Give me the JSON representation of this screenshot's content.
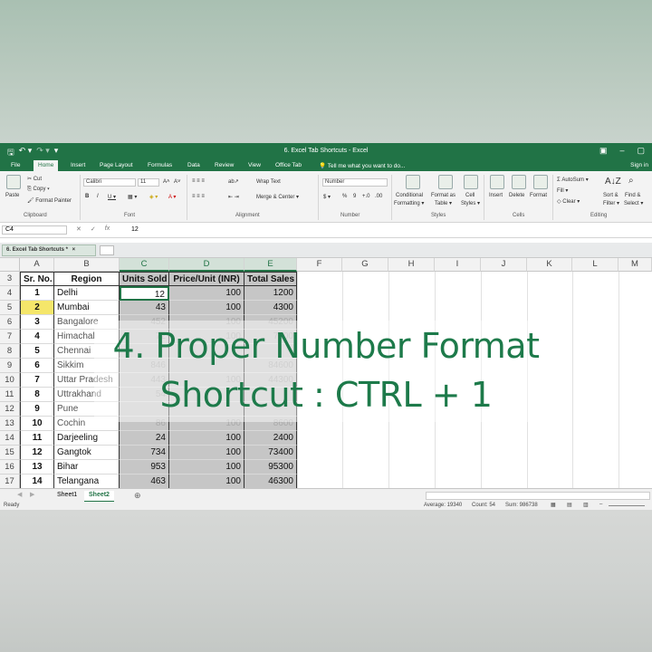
{
  "window": {
    "title": "6. Excel Tab Shortcuts - Excel",
    "sign_in": "Sign in",
    "qat_save": "🖫",
    "qat_undo": "↶ ▾",
    "qat_redo": "↷ ▾",
    "qat_more": "▾",
    "win_ribbon": "▣",
    "win_min": "–",
    "win_max": "▢"
  },
  "ribbon_tabs": [
    "File",
    "Home",
    "Insert",
    "Page Layout",
    "Formulas",
    "Data",
    "Review",
    "View",
    "Office Tab"
  ],
  "tell_me": "💡 Tell me what you want to do...",
  "ribbon": {
    "clipboard": {
      "paste": "Paste",
      "cut": "✂ Cut",
      "copy": "⎘ Copy ▾",
      "format_painter": "🖌 Format Painter",
      "label": "Clipboard"
    },
    "font": {
      "name": "Calibri",
      "size": "11",
      "grow": "A˄",
      "shrink": "A˅",
      "bold": "B",
      "italic": "I",
      "underline": "U ▾",
      "borders": "▦ ▾",
      "fill": "◈ ▾",
      "color": "A ▾",
      "label": "Font"
    },
    "alignment": {
      "wrap": "Wrap Text",
      "merge": "Merge & Center ▾",
      "label": "Alignment"
    },
    "number": {
      "format": "Number",
      "currency": "$ ▾",
      "percent": "%",
      "comma": "9",
      "inc": "+.0",
      "dec": ".00",
      "label": "Number"
    },
    "styles": {
      "cond": "Conditional",
      "cond2": "Formatting ▾",
      "table": "Format as",
      "table2": "Table ▾",
      "cell": "Cell",
      "cell2": "Styles ▾",
      "label": "Styles"
    },
    "cells": {
      "insert": "Insert",
      "delete": "Delete",
      "format": "Format",
      "label": "Cells"
    },
    "editing": {
      "autosum": "Σ AutoSum ▾",
      "fill": "Fill ▾",
      "clear": "◇ Clear ▾",
      "sort": "Sort &",
      "sort2": "Filter ▾",
      "find": "Find &",
      "find2": "Select ▾",
      "label": "Editing"
    }
  },
  "formula_bar": {
    "name_box": "C4",
    "cancel": "✕",
    "enter": "✓",
    "fx": "fx",
    "value": "12"
  },
  "file_tab": {
    "label": "6. Excel Tab Shortcuts *",
    "close": "×"
  },
  "columns": [
    "A",
    "B",
    "C",
    "D",
    "E",
    "F",
    "G",
    "H",
    "I",
    "J",
    "K",
    "L",
    "M"
  ],
  "headers": {
    "row": "3",
    "sr": "Sr. No.",
    "region": "Region",
    "units": "Units Sold",
    "price": "Price/Unit (INR)",
    "total": "Total Sales"
  },
  "rows": [
    {
      "row": "4",
      "sr": "1",
      "region": "Delhi",
      "units": "12",
      "price": "100",
      "total": "1200"
    },
    {
      "row": "5",
      "sr": "2",
      "region": "Mumbai",
      "units": "43",
      "price": "100",
      "total": "4300"
    },
    {
      "row": "6",
      "sr": "3",
      "region": "Bangalore",
      "units": "452",
      "price": "100",
      "total": "45200"
    },
    {
      "row": "7",
      "sr": "4",
      "region": "Himachal",
      "units": "72",
      "price": "100",
      "total": "7200"
    },
    {
      "row": "8",
      "sr": "5",
      "region": "Chennai",
      "units": "",
      "price": "",
      "total": ""
    },
    {
      "row": "9",
      "sr": "6",
      "region": "Sikkim",
      "units": "846",
      "price": "",
      "total": "84600"
    },
    {
      "row": "10",
      "sr": "7",
      "region": "Uttar Pradesh",
      "units": "443",
      "price": "100",
      "total": "44300"
    },
    {
      "row": "11",
      "sr": "8",
      "region": "Uttrakhand",
      "units": "54",
      "price": "",
      "total": ""
    },
    {
      "row": "12",
      "sr": "9",
      "region": "Pune",
      "units": "",
      "price": "",
      "total": ""
    },
    {
      "row": "13",
      "sr": "10",
      "region": "Cochin",
      "units": "86",
      "price": "100",
      "total": "8600"
    },
    {
      "row": "14",
      "sr": "11",
      "region": "Darjeeling",
      "units": "24",
      "price": "100",
      "total": "2400"
    },
    {
      "row": "15",
      "sr": "12",
      "region": "Gangtok",
      "units": "734",
      "price": "100",
      "total": "73400"
    },
    {
      "row": "16",
      "sr": "13",
      "region": "Bihar",
      "units": "953",
      "price": "100",
      "total": "95300"
    },
    {
      "row": "17",
      "sr": "14",
      "region": "Telangana",
      "units": "463",
      "price": "100",
      "total": "46300"
    }
  ],
  "caption": {
    "line1": "4. Proper Number Format",
    "line2": "Shortcut : CTRL + 1"
  },
  "sheets": {
    "nav_prev": "◀",
    "nav_next": "▶",
    "sheet1": "Sheet1",
    "sheet2": "Sheet2",
    "add": "⊕"
  },
  "status": {
    "ready": "Ready",
    "average": "Average: 19340",
    "count": "Count: 54",
    "sum": "Sum: 986738"
  },
  "colors": {
    "excel_green": "#217346",
    "caption_green": "#1d7a4a"
  }
}
